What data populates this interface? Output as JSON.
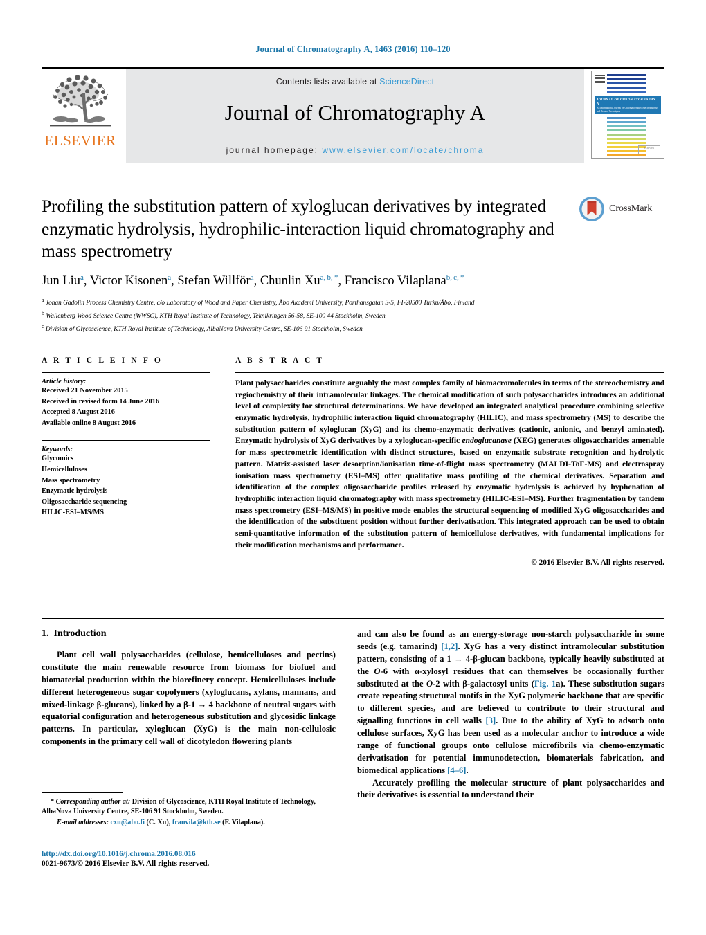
{
  "running_head": "Journal of Chromatography A, 1463 (2016) 110–120",
  "masthead": {
    "publisher": "ELSEVIER",
    "contents_prefix": "Contents lists available at ",
    "contents_link": "ScienceDirect",
    "journal_title": "Journal of Chromatography A",
    "homepage_prefix": "journal homepage: ",
    "homepage_link": "www.elsevier.com/locate/chroma",
    "cover": {
      "band_title": "JOURNAL OF CHROMATOGRAPHY A",
      "band_sub": "An International Journal on Chromatography, Electrophoresis and Related Techniques",
      "logo_text": "ELSEVIER"
    }
  },
  "crossmark": {
    "label": "CrossMark"
  },
  "article": {
    "title": "Profiling the substitution pattern of xyloglucan derivatives by integrated enzymatic hydrolysis, hydrophilic-interaction liquid chromatography and mass spectrometry",
    "authors_html": "Jun Liu<sup>a</sup>, Victor Kisonen<sup>a</sup>, Stefan Willför<sup>a</sup>, Chunlin Xu<sup>a, b, *</sup>, Francisco Vilaplana<sup>b, c, *</sup>",
    "affiliations": [
      {
        "mark": "a",
        "text": "Johan Gadolin Process Chemistry Centre, c/o Laboratory of Wood and Paper Chemistry, Åbo Akademi University, Porthansgatan 3-5, FI-20500 Turku/Åbo, Finland"
      },
      {
        "mark": "b",
        "text": "Wallenberg Wood Science Centre (WWSC), KTH Royal Institute of Technology, Teknikringen 56-58, SE-100 44 Stockholm, Sweden"
      },
      {
        "mark": "c",
        "text": "Division of Glycoscience, KTH Royal Institute of Technology, AlbaNova University Centre, SE-106 91 Stockholm, Sweden"
      }
    ]
  },
  "article_info": {
    "heading": "A R T I C L E   I N F O",
    "history_label": "Article history:",
    "history": [
      "Received 21 November 2015",
      "Received in revised form 14 June 2016",
      "Accepted 8 August 2016",
      "Available online 8 August 2016"
    ],
    "keywords_label": "Keywords:",
    "keywords": [
      "Glycomics",
      "Hemicelluloses",
      "Mass spectrometry",
      "Enzymatic hydrolysis",
      "Oligosaccharide sequencing",
      "HILIC-ESI–MS/MS"
    ]
  },
  "abstract": {
    "heading": "A B S T R A C T",
    "text_html": "Plant polysaccharides constitute arguably the most complex family of biomacromolecules in terms of the stereochemistry and regiochemistry of their intramolecular linkages. The chemical modification of such polysaccharides introduces an additional level of complexity for structural determinations. We have developed an integrated analytical procedure combining selective enzymatic hydrolysis, hydrophilic interaction liquid chromatography (HILIC), and mass spectrometry (MS) to describe the substitution pattern of xyloglucan (XyG) and its chemo-enzymatic derivatives (cationic, anionic, and benzyl aminated). Enzymatic hydrolysis of XyG derivatives by a xyloglucan-specific <i>endoglucanase</i> (XEG) generates oligosaccharides amenable for mass spectrometric identification with distinct structures, based on enzymatic substrate recognition and hydrolytic pattern. Matrix-assisted laser desorption/ionisation time-of-flight mass spectrometry (MALDI-ToF-MS) and electrospray ionisation mass spectrometry (ESI–MS) offer qualitative mass profiling of the chemical derivatives. Separation and identification of the complex oligosaccharide profiles released by enzymatic hydrolysis is achieved by hyphenation of hydrophilic interaction liquid chromatography with mass spectrometry (HILIC-ESI–MS). Further fragmentation by tandem mass spectrometry (ESI–MS/MS) in positive mode enables the structural sequencing of modified XyG oligosaccharides and the identification of the substituent position without further derivatisation. This integrated approach can be used to obtain semi-quantitative information of the substitution pattern of hemicellulose derivatives, with fundamental implications for their modification mechanisms and performance.",
    "copyright": "© 2016 Elsevier B.V. All rights reserved."
  },
  "body": {
    "section_number": "1.",
    "section_title": "Introduction",
    "left_paragraph_html": "Plant cell wall polysaccharides (cellulose, hemicelluloses and pectins) constitute the main renewable resource from biomass for biofuel and biomaterial production within the biorefinery concept. Hemicelluloses include different heterogeneous sugar copolymers (xyloglucans, xylans, mannans, and mixed-linkage β-glucans), linked by a β-1 → 4 backbone of neutral sugars with equatorial configuration and heterogeneous substitution and glycosidic linkage patterns. In particular, xyloglucan (XyG) is the main non-cellulosic components in the primary cell wall of dicotyledon flowering plants",
    "right_paragraph_1_html": "and can also be found as an energy-storage non-starch polysaccharide in some seeds (e.g. tamarind) <span class=\"ref\">[1,2]</span>. XyG has a very distinct intramolecular substitution pattern, consisting of a 1 → 4-β-glucan backbone, typically heavily substituted at the <i>O</i>-6 with α-xylosyl residues that can themselves be occasionally further substituted at the <i>O</i>-2 with β-galactosyl units (<span class=\"ref\">Fig. 1</span>a). These substitution sugars create repeating structural motifs in the XyG polymeric backbone that are specific to different species, and are believed to contribute to their structural and signalling functions in cell walls <span class=\"ref\">[3]</span>. Due to the ability of XyG to adsorb onto cellulose surfaces, XyG has been used as a molecular anchor to introduce a wide range of functional groups onto cellulose microfibrils via chemo-enzymatic derivatisation for potential immunodetection, biomaterials fabrication, and biomedical applications <span class=\"ref\">[4–6]</span>.",
    "right_paragraph_2_html": "Accurately profiling the molecular structure of plant polysaccharides and their derivatives is essential to understand their"
  },
  "footnotes": {
    "corresponding_html": "<b>*</b> <i>Corresponding author at:</i> Division of Glycoscience, KTH Royal Institute of Technology, AlbaNova University Centre, SE-106 91 Stockholm, Sweden.",
    "email_label": "E-mail addresses:",
    "emails": [
      {
        "address": "cxu@abo.fi",
        "owner": "(C. Xu)"
      },
      {
        "address": "franvila@kth.se",
        "owner": "(F. Vilaplana)"
      }
    ]
  },
  "footer": {
    "doi": "http://dx.doi.org/10.1016/j.chroma.2016.08.016",
    "issn_line": "0021-9673/© 2016 Elsevier B.V. All rights reserved."
  },
  "colors": {
    "link_blue": "#1a75a8",
    "light_blue": "#3a9bd4",
    "elsevier_orange": "#E87722",
    "band_gray": "#e6e7e8"
  }
}
